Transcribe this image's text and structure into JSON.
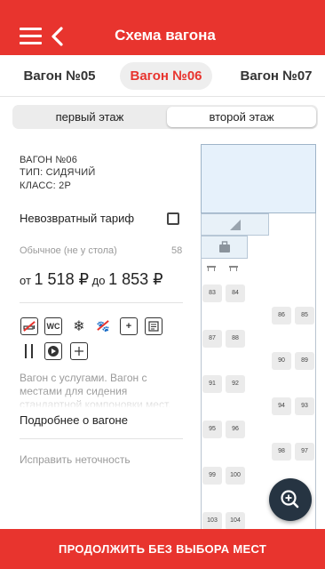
{
  "header": {
    "title": "Схема вагона"
  },
  "wagon_tabs": [
    {
      "label": "Вагон №05",
      "active": false
    },
    {
      "label": "Вагон №06",
      "active": true
    },
    {
      "label": "Вагон №07",
      "active": false
    }
  ],
  "floors": {
    "first": "первый этаж",
    "second": "второй этаж",
    "selected": "second"
  },
  "wagon_info": {
    "number": "ВАГОН №06",
    "type": "ТИП: СИДЯЧИЙ",
    "class": "КЛАСС: 2Р"
  },
  "tariff": {
    "label": "Невозвратный тариф",
    "checked": false
  },
  "seat_category": {
    "name": "Обычное (не у стола)",
    "count": "58"
  },
  "price": {
    "from_label": "от",
    "from": "1 518 ₽",
    "to_label": "до",
    "to": "1 853 ₽"
  },
  "services": [
    "no-smoking-icon",
    "wc-icon",
    "air-conditioning-icon",
    "no-pets-icon",
    "first-aid-icon",
    "press-icon",
    "food-icon",
    "media-icon",
    "outlet-icon"
  ],
  "description": "Вагон с услугами. Вагон с местами для сидения стандартной компоновки мест.",
  "links": {
    "more": "Подробнее о вагоне",
    "fix": "Исправить неточность"
  },
  "seats": [
    "83",
    "84",
    "86",
    "85",
    "87",
    "88",
    "90",
    "89",
    "91",
    "92",
    "94",
    "93",
    "95",
    "96",
    "98",
    "97",
    "99",
    "100",
    "103",
    "104"
  ],
  "bottom_button": "ПРОДОЛЖИТЬ БЕЗ ВЫБОРА МЕСТ",
  "colors": {
    "accent": "#e8342e",
    "fab": "#263442"
  }
}
